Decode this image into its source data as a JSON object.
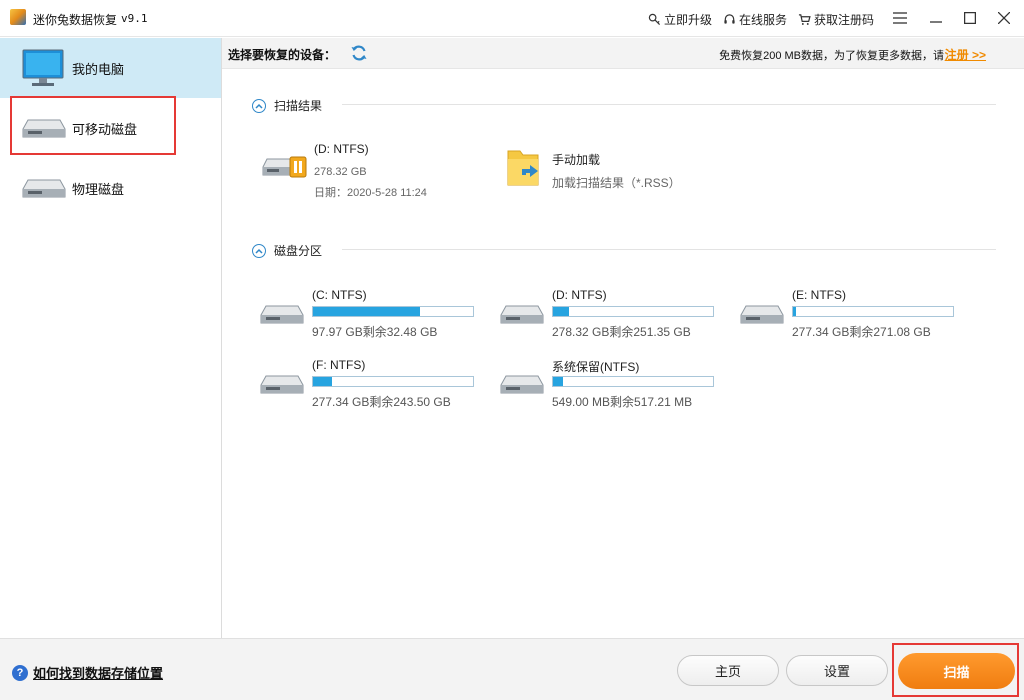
{
  "app": {
    "title": "迷你兔数据恢复",
    "version": "v9.1"
  },
  "titlebar": {
    "links": [
      {
        "label": "立即升级",
        "icon": "key-icon"
      },
      {
        "label": "在线服务",
        "icon": "headset-icon"
      },
      {
        "label": "获取注册码",
        "icon": "cart-icon"
      }
    ]
  },
  "sidebar": {
    "items": [
      {
        "label": "我的电脑",
        "icon": "monitor-icon",
        "active": true
      },
      {
        "label": "可移动磁盘",
        "icon": "removable-drive-icon",
        "active": false
      },
      {
        "label": "物理磁盘",
        "icon": "physical-disk-icon",
        "active": false
      }
    ]
  },
  "header": {
    "select_label": "选择要恢复的设备：",
    "free_text": "免费恢复200 MB数据，为了恢复更多数据，请",
    "register_label": "注册 >>"
  },
  "scan_results": {
    "title": "扫描结果",
    "drive": {
      "name": "(D: NTFS)",
      "size": "278.32 GB",
      "date": "日期：2020-5-28 11:24"
    },
    "manual": {
      "title": "手动加载",
      "subtitle": "加载扫描结果（*.RSS）"
    }
  },
  "partitions": {
    "title": "磁盘分区",
    "items": [
      {
        "name": "(C: NTFS)",
        "info": "97.97 GB剩余32.48 GB",
        "used_fraction": 0.67
      },
      {
        "name": "(D: NTFS)",
        "info": "278.32 GB剩余251.35 GB",
        "used_fraction": 0.1
      },
      {
        "name": "(E: NTFS)",
        "info": "277.34 GB剩余271.08 GB",
        "used_fraction": 0.02
      },
      {
        "name": "(F: NTFS)",
        "info": "277.34 GB剩余243.50 GB",
        "used_fraction": 0.12
      },
      {
        "name": "系统保留(NTFS)",
        "info": "549.00 MB剩余517.21 MB",
        "used_fraction": 0.06
      }
    ]
  },
  "footer": {
    "help_label": "如何找到数据存储位置",
    "home_label": "主页",
    "settings_label": "设置",
    "scan_label": "扫描"
  },
  "colors": {
    "accent_orange": "#f08a00",
    "bar_blue": "#27a4e0",
    "sidebar_active": "#cfeaf6",
    "highlight_red": "#e53935"
  }
}
